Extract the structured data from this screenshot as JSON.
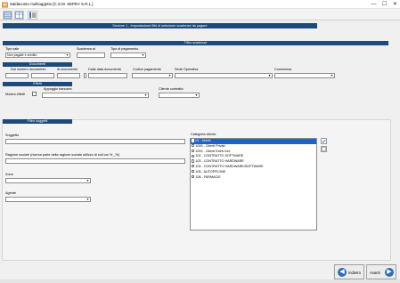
{
  "window": {
    "title": "Saldaconto multioggetto [C.S.M. SEPEV S.R.L.]",
    "controls": [
      "—",
      "☐",
      "✕"
    ]
  },
  "toolbar": {
    "buttons": [
      "grid-view-icon",
      "table-icon",
      "filter-list-icon"
    ]
  },
  "header": {
    "step_title": "Sezione 1 - Impostazione filtri di selezione scadenze da pagare"
  },
  "filtro_scadenze": {
    "title": "Filtro scadenze",
    "tipo_label": "Tipo sale",
    "tipo_value": "Non pagate e credito",
    "scadenza_label": "Scadenza al",
    "scadenza_value": "",
    "tipo_pagamento_label": "Tipo di pagamento",
    "tipo_pagamento_value": ""
  },
  "documenti": {
    "title": "Documenti",
    "dal_numero_label": "Dal numero documento",
    "al_documento_label": "Al documento",
    "dalla_data_label": "Dalla data documento",
    "codice_pagamento_label": "Codice pagamento",
    "sede_operativa_label": "Sede Operativa",
    "commessa_label": "Commessa"
  },
  "effetti": {
    "title": "Effetti",
    "check_label": "Mostra effetti",
    "appoggio_label": "Appoggio bancario",
    "cliente_label": "Cliente contratto"
  },
  "filtro_soggetti": {
    "title": "Filtro soggetti",
    "soggetto_label": "Soggetto",
    "soggetto_value": "",
    "ragione_label": "Ragione sociale (ricerca parte della ragione sociale utilizzo di soli car % _%)",
    "ragione_value": "",
    "zona_label": "Zona",
    "zona_value": "",
    "agente_label": "Agente",
    "agente_value": "",
    "categoria_label": "Categoria cliente",
    "categoria_items": [
      {
        "label": "01 - Utenti",
        "selected": true
      },
      {
        "label": "1000 - Clienti Privati",
        "selected": false
      },
      {
        "label": "1002 - Clienti Extra Cee",
        "selected": false
      },
      {
        "label": "102 - CONTRATTO SOFTWARE",
        "selected": false
      },
      {
        "label": "103 - CONTRATTO HARDWARE",
        "selected": false
      },
      {
        "label": "104 - CONTRATTO HARDWARE/SOFTWARE",
        "selected": false
      },
      {
        "label": "105 - AUTOFFICINE",
        "selected": false
      },
      {
        "label": "106 - FARMACIE",
        "selected": false
      }
    ]
  },
  "footer": {
    "back_label": "Indietro",
    "next_label": "Avanti"
  },
  "colors": {
    "header_blue": "#1c4a7c",
    "selection_blue": "#1e64c8",
    "button_icon_blue": "#2e6db4"
  }
}
